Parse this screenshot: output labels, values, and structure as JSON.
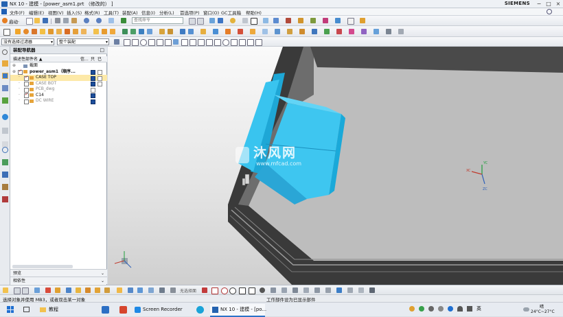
{
  "window": {
    "title": "NX 10 - 建模 - [power_asm1.prt （修改的） ]",
    "brand": "SIEMENS"
  },
  "menu": [
    "文件(F)",
    "编辑(E)",
    "视图(V)",
    "插入(S)",
    "格式(R)",
    "工具(T)",
    "装配(A)",
    "信息(I)",
    "分析(L)",
    "首选项(P)",
    "窗口(O)",
    "GC工具箱",
    "帮助(H)"
  ],
  "toolbar": {
    "start_label": "启动·",
    "search_placeholder": "查找命令",
    "filter_value": "没有选择过滤器",
    "scope_value": "整个装配"
  },
  "nav": {
    "title": "装配导航器",
    "col_name": "描述性部件名 ▲",
    "col_info": "信...",
    "col_r": "只",
    "col_s": "已",
    "rows": [
      {
        "name": "截面",
        "level": 1,
        "sel": false,
        "check": "none",
        "pa": false,
        "pb": false
      },
      {
        "name": "power_asm1（顺序...",
        "level": 1,
        "sel": false,
        "check": "on",
        "pa": true,
        "pb": true
      },
      {
        "name": "CASE TOP",
        "level": 2,
        "sel": true,
        "check": "on",
        "pa": true,
        "pb": true
      },
      {
        "name": "CASE BOT",
        "level": 2,
        "sel": false,
        "check": "off",
        "pa": true,
        "pb": true
      },
      {
        "name": "PCB_dwg",
        "level": 2,
        "sel": false,
        "check": "off",
        "pa": false,
        "pb": false
      },
      {
        "name": "C14",
        "level": 2,
        "sel": false,
        "check": "on",
        "pa": true,
        "pb": false
      },
      {
        "name": "DC WIRE",
        "level": 2,
        "sel": false,
        "check": "off",
        "pa": true,
        "pb": false
      }
    ],
    "preview_label": "预览",
    "dependency_label": "相依性"
  },
  "viewport": {
    "watermark_cn": "沐风网",
    "watermark_url": "www.mfcad.com",
    "triad_center": {
      "x": "XC",
      "y": "YC",
      "z": "ZC"
    }
  },
  "bottom_toolbar": {
    "filter_label": "无选择面"
  },
  "status": {
    "left": "选择对象并使用 MB3，或者双击某一对象",
    "right": "工作部件设为已显示部件"
  },
  "taskbar": {
    "items": [
      "教程",
      "Screen Recorder",
      "NX 10 - 建模 - [po..."
    ],
    "ime": "英",
    "time": "晴",
    "weather": "24°C~27°C"
  },
  "colors": {
    "accent_blue": "#2b73c9",
    "part_cyan": "#3ec6f0",
    "selection_yellow": "#fde9a8"
  }
}
